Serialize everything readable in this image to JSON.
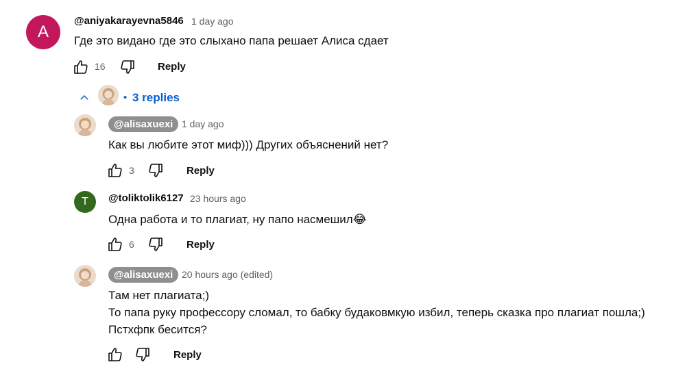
{
  "colors": {
    "accent_blue": "#065fd4",
    "avatar_a": "#c2185b",
    "avatar_t": "#33691e",
    "pill_bg": "#8f8f8f"
  },
  "top_comment": {
    "avatar_letter": "A",
    "author": "@aniyakarayevna5846",
    "time": "1 day ago",
    "text": "Где это видано где это слыхано папа решает Алиса сдает",
    "likes": "16",
    "reply_label": "Reply"
  },
  "replies_toggle": {
    "label": "3 replies",
    "dot": "•"
  },
  "replies": [
    {
      "author": "@alisaxuexi",
      "time": "1 day ago",
      "text_lines": [
        "Как вы любите этот миф))) Других объяснений нет?"
      ],
      "likes": "3",
      "reply_label": "Reply"
    },
    {
      "avatar_letter": "T",
      "author": "@toliktolik6127",
      "time": "23 hours ago",
      "text_lines": [
        "Одна работа и то плагиат, ну папо насмешил😂"
      ],
      "likes": "6",
      "reply_label": "Reply"
    },
    {
      "author": "@alisaxuexi",
      "time": "20 hours ago (edited)",
      "text_lines": [
        "Там нет плагиата;)",
        "То папа руку профессору сломал, то бабку будаковмкую избил, теперь сказка про плагиат пошла;)",
        "Пстхфпк бесится?"
      ],
      "likes": "",
      "reply_label": "Reply"
    }
  ]
}
